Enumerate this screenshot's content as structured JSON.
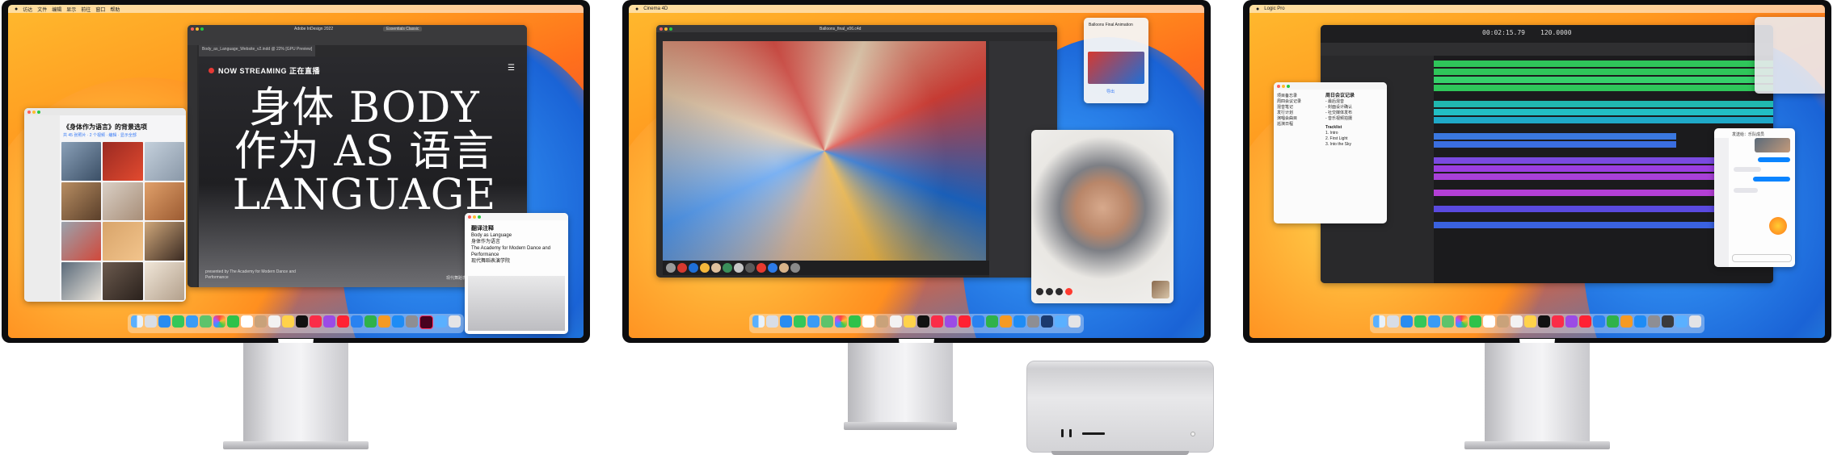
{
  "monitor1": {
    "indesign": {
      "window_title": "Adobe InDesign 2022",
      "workspace": "Essentials Classic",
      "doc_tab": "Body_as_Language_Website_v2.indd @ 22% [GPU Preview]",
      "now_streaming": "NOW STREAMING 正在直播",
      "headline": [
        "身体 BODY",
        "作为 AS 语言",
        "LANGUAGE"
      ],
      "credit_left": "presented by The Academy for Modern Dance and Performance",
      "credit_right": "现代舞蹈表演学院"
    },
    "photos": {
      "title": "《身体作为语言》的背景选项",
      "subtitle": "共 45 张照片 · 2 个视频 · 编辑 · 显示全部"
    },
    "note": {
      "heading": "翻译注释",
      "lines": [
        "Body as Language",
        "身体作为语言",
        "The Academy for Modern Dance and Performance",
        "现代舞蹈表演学院"
      ]
    },
    "menu": [
      " ",
      "访达",
      "文件",
      "编辑",
      "显示",
      "前往",
      "窗口",
      "帮助"
    ]
  },
  "monitor2": {
    "app": "Cinema 4D",
    "window_title": "Balloons_final_v06.c4d",
    "widget_caption": "Balloons Final Animation",
    "widget_action": "导出"
  },
  "monitor3": {
    "app": "Logic Pro",
    "lcd_time": "00:02:15.79",
    "lcd_tempo": "120.0000",
    "notes": {
      "left_items": [
        "项目备忘录",
        "周四会议记录",
        "混音笔记",
        "发行计划",
        "演唱会曲目",
        "巡演日程"
      ],
      "right_title": "周日会议记录",
      "right_items": [
        "- 最后混音",
        "- 封面设计确认",
        "- 社交媒体发布",
        "- 音乐视频拍摄",
        "Tracklist",
        "1. Intro",
        "2. First Light",
        "3. Into the Sky"
      ]
    },
    "messages": {
      "recipient": "发送给：乐队成员"
    }
  }
}
